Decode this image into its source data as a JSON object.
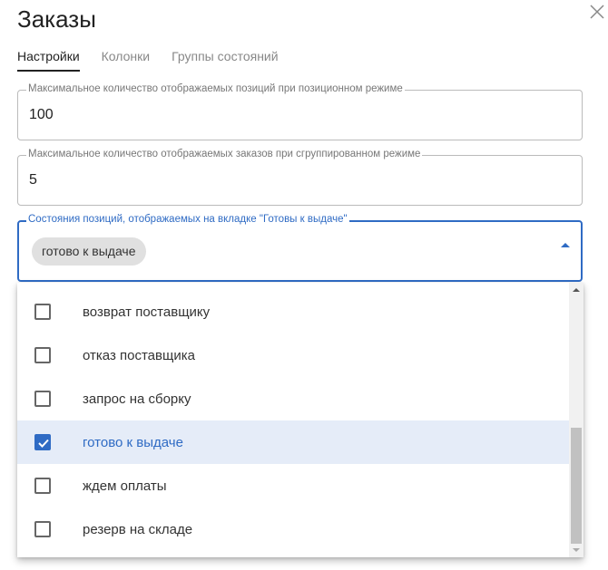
{
  "title": "Заказы",
  "tabs": [
    {
      "label": "Настройки",
      "active": true
    },
    {
      "label": "Колонки"
    },
    {
      "label": "Группы состояний"
    }
  ],
  "fields": {
    "max_positions": {
      "label": "Максимальное количество отображаемых позиций при позиционном режиме",
      "value": "100"
    },
    "max_orders": {
      "label": "Максимальное количество отображаемых заказов при сгруппированном режиме",
      "value": "5"
    },
    "ready_states": {
      "label": "Состояния позиций, отображаемых на вкладке \"Готовы к выдаче\"",
      "chips": [
        "готово к выдаче"
      ]
    }
  },
  "options": [
    {
      "label": "возврат поставщику",
      "checked": false
    },
    {
      "label": "отказ поставщика",
      "checked": false
    },
    {
      "label": "запрос на сборку",
      "checked": false
    },
    {
      "label": "готово к выдаче",
      "checked": true
    },
    {
      "label": "ждем оплаты",
      "checked": false
    },
    {
      "label": "резерв на складе",
      "checked": false
    }
  ],
  "accent": "#2f6bc4"
}
